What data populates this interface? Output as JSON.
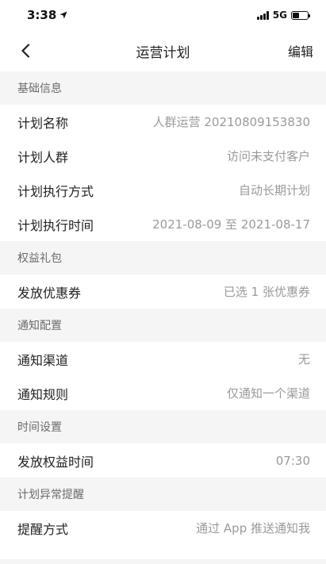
{
  "status": {
    "time": "3:38",
    "network": "5G",
    "battery_level": 0.45
  },
  "nav": {
    "title": "运营计划",
    "edit_label": "编辑"
  },
  "sections": [
    {
      "title": "基础信息",
      "rows": [
        {
          "label": "计划名称",
          "value": "人群运营 20210809153830"
        },
        {
          "label": "计划人群",
          "value": "访问未支付客户"
        },
        {
          "label": "计划执行方式",
          "value": "自动长期计划"
        },
        {
          "label": "计划执行时间",
          "value": "2021-08-09 至 2021-08-17"
        }
      ]
    },
    {
      "title": "权益礼包",
      "rows": [
        {
          "label": "发放优惠券",
          "value": "已选 1 张优惠券"
        }
      ]
    },
    {
      "title": "通知配置",
      "rows": [
        {
          "label": "通知渠道",
          "value": "无"
        },
        {
          "label": "通知规则",
          "value": "仅通知一个渠道"
        }
      ]
    },
    {
      "title": "时间设置",
      "rows": [
        {
          "label": "发放权益时间",
          "value": "07:30"
        }
      ]
    },
    {
      "title": "计划异常提醒",
      "rows": [
        {
          "label": "提醒方式",
          "value": "通过 App 推送通知我"
        }
      ]
    }
  ]
}
